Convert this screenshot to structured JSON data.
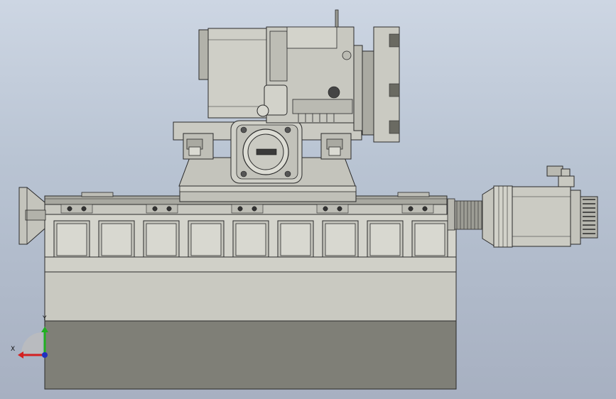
{
  "view": {
    "colors": {
      "background_top": "#cdd6e3",
      "background_bottom": "#a7b0c1",
      "part_light": "#d2d2ca",
      "part_mid": "#bcbcb4",
      "part_dark": "#7f7f77",
      "edge": "#2a2a2a",
      "axis_x": "#d42020",
      "axis_y": "#20b020",
      "axis_z": "#2030c0"
    }
  },
  "triad": {
    "x_label": "X",
    "y_label": "Y"
  },
  "model": {
    "base_panel_count": 9,
    "rail_screw_pairs": 5
  }
}
